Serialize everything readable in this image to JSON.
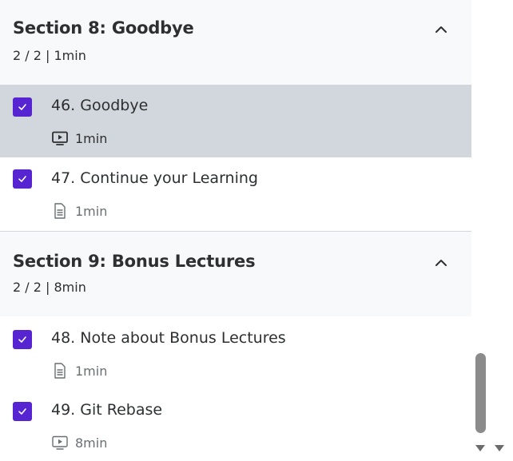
{
  "sections": [
    {
      "title": "Section 8: Goodbye",
      "meta": "2 / 2 | 1min",
      "chevron_icon": "chevron-up-icon",
      "items": [
        {
          "title": "46. Goodbye",
          "duration": "1min",
          "type_icon": "video-icon",
          "completed": true,
          "active": true
        },
        {
          "title": "47. Continue your Learning",
          "duration": "1min",
          "type_icon": "document-icon",
          "completed": true,
          "active": false
        }
      ]
    },
    {
      "title": "Section 9: Bonus Lectures",
      "meta": "2 / 2 | 8min",
      "chevron_icon": "chevron-up-icon",
      "items": [
        {
          "title": "48. Note about Bonus Lectures",
          "duration": "1min",
          "type_icon": "document-icon",
          "completed": true,
          "active": false
        },
        {
          "title": "49. Git Rebase",
          "duration": "8min",
          "type_icon": "video-icon",
          "completed": true,
          "active": false
        }
      ]
    }
  ],
  "colors": {
    "accent": "#5624d0",
    "active_row": "#d1d7dc",
    "section_bg": "#f7f9fa",
    "text": "#2d2f31",
    "muted_text": "#6a6f73",
    "scrollbar_thumb": "#8b8b8b"
  }
}
